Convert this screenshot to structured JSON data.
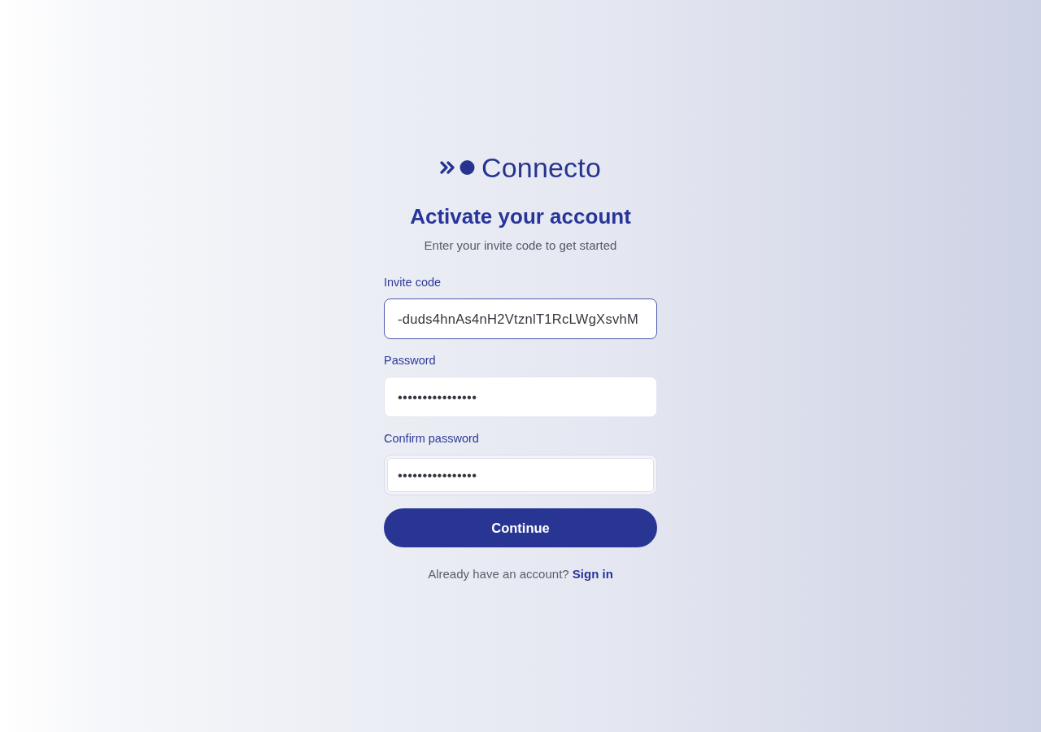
{
  "logo": {
    "name": "Connecto"
  },
  "heading": "Activate your account",
  "subheading": "Enter your invite code to get started",
  "fields": [
    {
      "label": "Invite code",
      "value": "-duds4hnAs4nH2VtznlT1RcLWgXsvhM",
      "focused": true,
      "hovered": false
    },
    {
      "label": "Password",
      "value": "••••••••••••••••",
      "focused": false,
      "hovered": false
    },
    {
      "label": "Confirm password",
      "value": "••••••••••••••••",
      "focused": false,
      "hovered": true
    }
  ],
  "submit": "Continue",
  "footer": {
    "text": "Already have an account?",
    "link": "Sign in"
  }
}
